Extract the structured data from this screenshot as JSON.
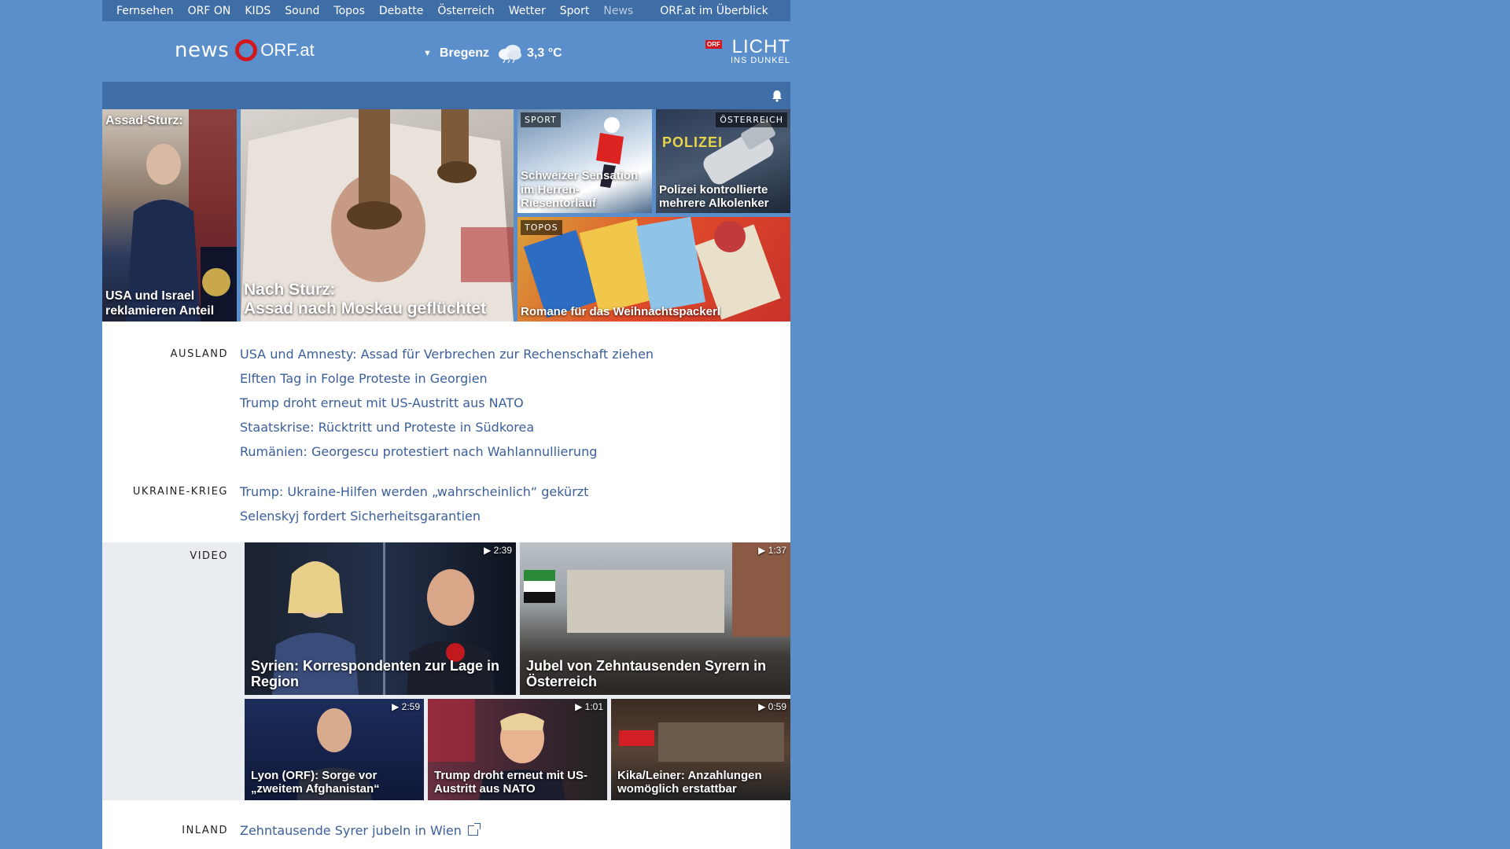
{
  "topnav": {
    "items": [
      "Fernsehen",
      "ORF ON",
      "KIDS",
      "Sound",
      "Topos",
      "Debatte",
      "Österreich",
      "Wetter",
      "Sport",
      "News"
    ],
    "overview": "ORF.at im Überblick"
  },
  "header": {
    "logo_news": "news",
    "logo_orf": "ORF.at",
    "weather": {
      "city": "Bregenz",
      "temp": "3,3 °C",
      "icon": "cloud-rain-icon"
    },
    "licht": {
      "badge": "ORF",
      "line1": "LICHT",
      "line2": "INS DUNKEL"
    }
  },
  "hero": {
    "tile1": {
      "top_label": "Assad-Sturz:",
      "caption_l1": "USA und Israel",
      "caption_l2": "reklamieren Anteil"
    },
    "tile2": {
      "caption_l1": "Nach Sturz:",
      "caption_l2": "Assad nach Moskau geflüchtet"
    },
    "tile3": {
      "tag": "SPORT",
      "caption_l1": "Schweizer Sensation",
      "caption_l2": "im Herren-Riesentorlauf"
    },
    "tile4": {
      "tag": "ÖSTERREICH",
      "caption_l1": "Polizei kontrollierte",
      "caption_l2": "mehrere Alkolenker",
      "image_text": "POLIZEI"
    },
    "tile5": {
      "tag": "TOPOS",
      "caption": "Romane für das Weihnachtspackerl"
    }
  },
  "sections": {
    "ausland": {
      "label": "AUSLAND",
      "links": [
        "USA und Amnesty: Assad für Verbrechen zur Rechenschaft ziehen",
        "Elften Tag in Folge Proteste in Georgien",
        "Trump droht erneut mit US-Austritt aus NATO",
        "Staatskrise: Rücktritt und Proteste in Südkorea",
        "Rumänien: Georgescu protestiert nach Wahlannullierung"
      ]
    },
    "ukraine": {
      "label": "UKRAINE-KRIEG",
      "links": [
        "Trump: Ukraine-Hilfen werden „wahrscheinlich“ gekürzt",
        "Selenskyj fordert Sicherheitsgarantien"
      ]
    },
    "video": {
      "label": "VIDEO",
      "items": [
        {
          "duration": "2:39",
          "caption": "Syrien: Korrespondenten zur Lage in Region"
        },
        {
          "duration": "1:37",
          "caption": "Jubel von Zehntausenden Syrern in Österreich"
        },
        {
          "duration": "2:59",
          "caption": "Lyon (ORF): Sorge vor „zweitem Afghanistan“"
        },
        {
          "duration": "1:01",
          "caption": "Trump droht erneut mit US-Austritt aus NATO"
        },
        {
          "duration": "0:59",
          "caption": "Kika/Leiner: Anzahlungen womöglich erstattbar"
        }
      ]
    },
    "inland": {
      "label": "INLAND",
      "links": [
        "Zehntausende Syrer jubeln in Wien"
      ]
    }
  },
  "colors": {
    "background": "#5b8fcb",
    "nav": "#3f6da5",
    "link": "#3b5f99",
    "orf_red": "#d2181e"
  }
}
